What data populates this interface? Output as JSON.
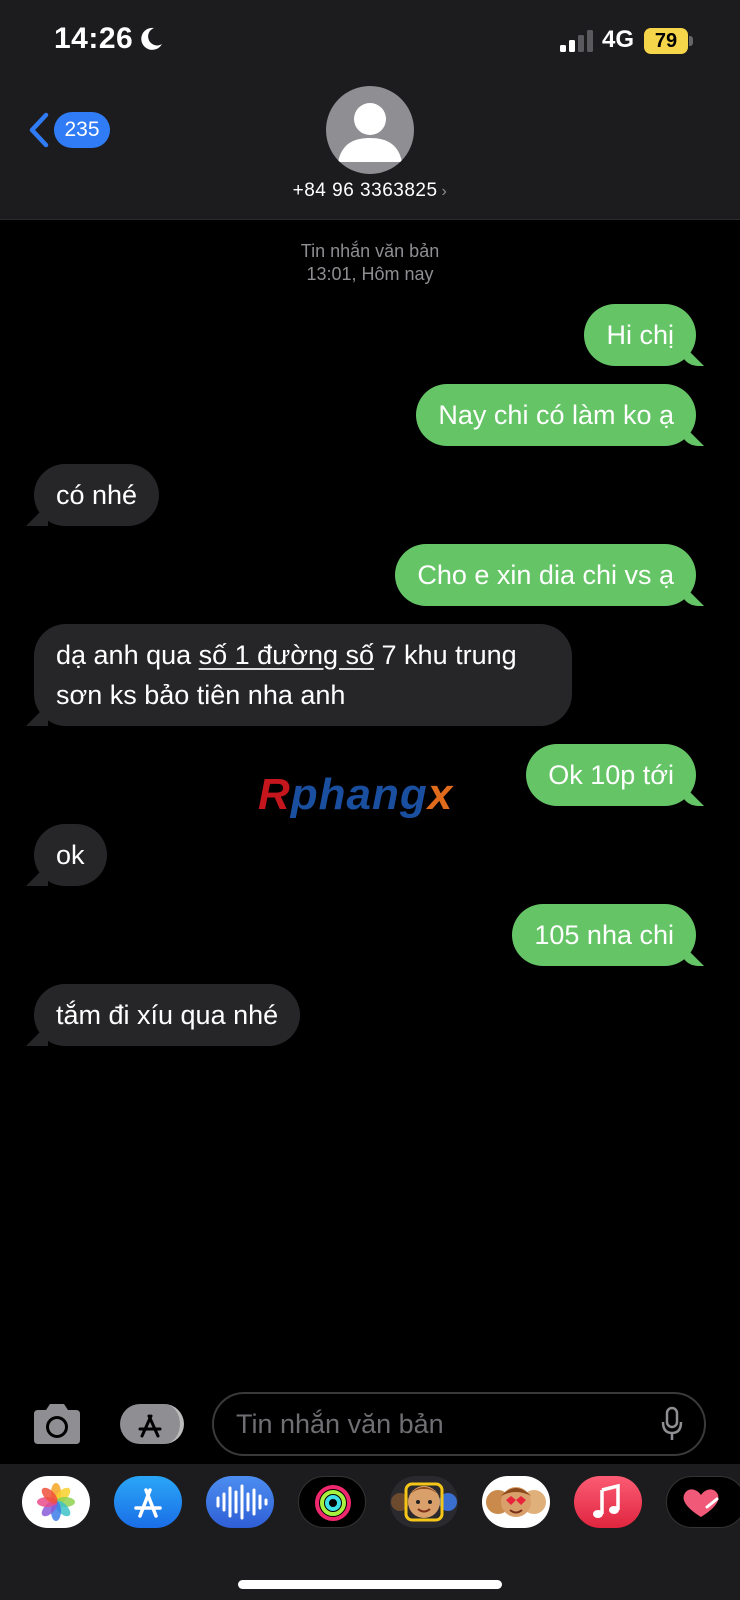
{
  "status_bar": {
    "time": "14:26",
    "network": "4G",
    "battery": "79",
    "colors": {
      "battery": "#f5d64a"
    }
  },
  "header": {
    "back_count": "235",
    "contact": "+84 96 3363825",
    "colors": {
      "badge": "#2f7cf6"
    }
  },
  "conversation": {
    "stamp_type": "Tin nhắn văn bản",
    "stamp_time": "13:01, Hôm nay",
    "colors": {
      "outgoing": "#65c466",
      "incoming": "#262629"
    },
    "messages": [
      {
        "dir": "out",
        "text": "Hi chị"
      },
      {
        "dir": "out",
        "text": "Nay chi có làm ko ạ"
      },
      {
        "dir": "in",
        "text": "có nhé"
      },
      {
        "dir": "out",
        "text": "Cho e xin dia chi vs ạ"
      },
      {
        "dir": "in",
        "text_before": "dạ anh qua ",
        "text_link": "số 1 đường số",
        "text_after_line1": " 7 khu trung",
        "text_line2": "sơn ks bảo tiên nha anh"
      },
      {
        "dir": "out",
        "text": "Ok 10p tới"
      },
      {
        "dir": "in",
        "text": "ok"
      },
      {
        "dir": "out",
        "text": "105 nha chi"
      },
      {
        "dir": "in",
        "text": "tắm đi xíu qua nhé"
      }
    ]
  },
  "watermark": {
    "part1": "R",
    "part2": "phang",
    "part3": "x"
  },
  "input_bar": {
    "placeholder": "Tin nhắn văn bản",
    "icons": [
      "camera-icon",
      "app-store-apps-icon",
      "microphone-icon"
    ]
  },
  "app_drawer": {
    "apps": [
      "photos-app-icon",
      "app-store-icon",
      "audio-message-icon",
      "fitness-activity-icon",
      "memoji-icon",
      "memoji-stickers-icon",
      "music-app-icon",
      "digital-touch-icon"
    ]
  }
}
